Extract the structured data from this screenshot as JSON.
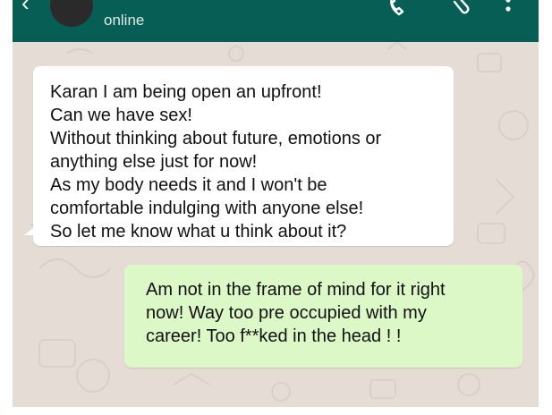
{
  "header": {
    "status": "online",
    "icons": [
      "back-arrow-icon",
      "call-icon",
      "attach-icon",
      "more-menu-icon"
    ]
  },
  "messages": [
    {
      "direction": "incoming",
      "lines": [
        "Karan I am being open an upfront!",
        "Can we have sex!",
        "Without thinking about future, emotions or",
        "anything else just for now!",
        "As my body needs it and I won't be",
        "comfortable indulging with anyone else!",
        "So let me know what u think about it?"
      ]
    },
    {
      "direction": "outgoing",
      "lines": [
        "Am not in the frame of mind for it right",
        "now! Way too pre occupied with my",
        "career! Too f**ked in the head ! !"
      ]
    }
  ],
  "colors": {
    "header": "#075e54",
    "chat_background": "#e5ddd5",
    "incoming_bubble": "#ffffff",
    "outgoing_bubble": "#dcf8c6"
  }
}
